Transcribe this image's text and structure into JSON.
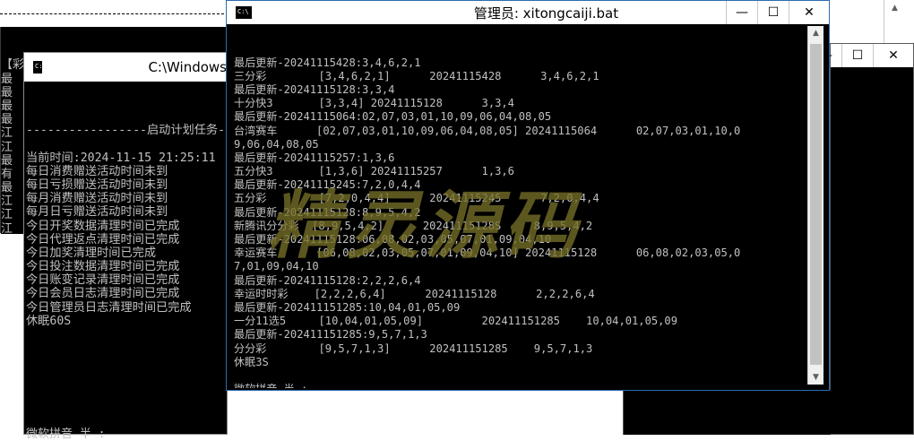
{
  "bg_window": {
    "lines": [
      "【彩种】          【状态】",
      "最",
      "最",
      "最",
      "最",
      "江",
      "江",
      "最",
      "有",
      "最",
      "江",
      "江",
      "江",
      "",
      "",
      "微"
    ]
  },
  "cmd_window": {
    "title": "C:\\Windows",
    "lines": [
      "",
      "-----------------启动计划任务--",
      "",
      "当前时间:2024-11-15 21:25:11",
      "每日消费赠送活动时间未到",
      "每日亏损赠送活动时间未到",
      "每月消费赠送活动时间未到",
      "每月日亏赠送活动时间未到",
      "今日开奖数据清理时间已完成",
      "今日代理返点清理时间已完成",
      "今日加奖清理时间已完成",
      "今日投注数据清理时间已完成",
      "今日账变记录清理时间已完成",
      "今日会员日志清理时间已完成",
      "今日管理员日志清理时间已完成",
      "休眠60S"
    ],
    "ime": "微软拼音 半 :"
  },
  "main_window": {
    "title": "管理员: xitongcaiji.bat",
    "controls": {
      "minimize": "—",
      "maximize": "☐",
      "close": "✕"
    },
    "lines": [
      "最后更新-20241115428:3,4,6,2,1",
      "三分彩        [3,4,6,2,1]      20241115428      3,4,6,2,1",
      "最后更新-20241115128:3,3,4",
      "十分快3       [3,3,4] 20241115128      3,3,4",
      "最后更新-20241115064:02,07,03,01,10,09,06,04,08,05",
      "台湾赛车      [02,07,03,01,10,09,06,04,08,05] 20241115064      02,07,03,01,10,0",
      "9,06,04,08,05",
      "最后更新-20241115257:1,3,6",
      "五分快3       [1,3,6] 20241115257      1,3,6",
      "最后更新-20241115245:7,2,0,4,4",
      "五分彩        [7,2,0,4,4]      20241115245      7,2,0,4,4",
      "最后更新-20241115128:8,9,5,4,2",
      "新腾讯分分彩  [8,9,5,4,2]      20241115128S     8,9,5,4,2",
      "最后更新-20241115128:06,08,02,03,05,07,01,09,04,10",
      "幸运赛车      [06,08,02,03,05,07,01,09,04,10] 20241115128      06,08,02,03,05,0",
      "7,01,09,04,10",
      "最后更新-20241115128:2,2,2,6,4",
      "幸运时时彩    [2,2,2,6,4]      20241115128      2,2,2,6,4",
      "最后更新-202411151285:10,04,01,05,09",
      "一分11选5     [10,04,01,05,09]         202411151285    10,04,01,05,09",
      "最后更新-202411151285:9,5,7,1,3",
      "分分彩        [9,5,7,1,3]      202411151285    9,5,7,1,3",
      "休眠3S",
      "",
      "微软拼音 半 :"
    ]
  },
  "right_window": {
    "controls": {
      "minimize": "—",
      "maximize": "☐",
      "close": "✕"
    }
  },
  "watermark": "精灵源码",
  "colors": {
    "console_bg": "#000000",
    "console_text": "#c0c0c0",
    "watermark": "#76702a"
  }
}
